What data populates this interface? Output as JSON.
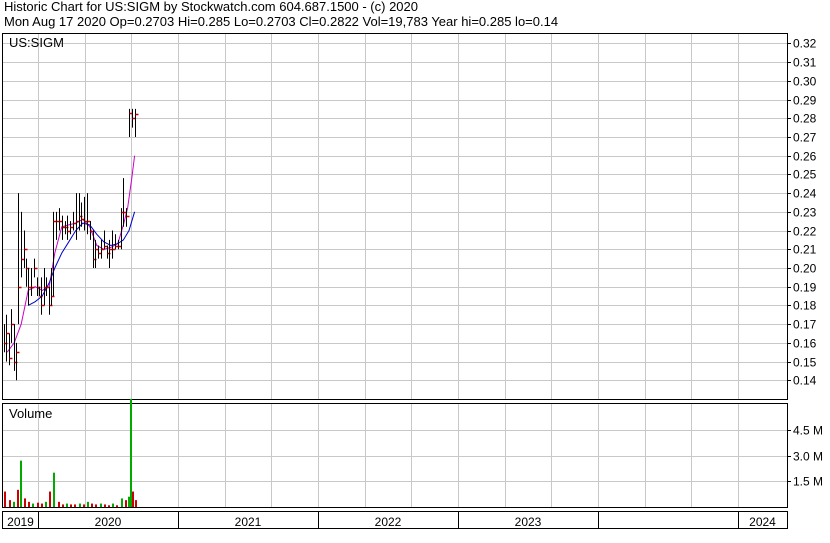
{
  "header": {
    "line1": "Historic Chart for US:SIGM by Stockwatch.com 604.687.1500 - (c) 2020",
    "line2": "Mon Aug 17 2020   Op=0.2703   Hi=0.285   Lo=0.2703   Cl=0.2822   Vol=19,783   Year hi=0.285   lo=0.14"
  },
  "colors": {
    "price_bar": "#000000",
    "close_tick": "#cc0000",
    "ma_short": "#cc00cc",
    "ma_long": "#0000cc",
    "volume_up": "#00aa00",
    "volume_down": "#cc0000",
    "grid": "#c8c8c8"
  },
  "chart_data": [
    {
      "type": "bar",
      "subtype": "ohlc",
      "title": "US:SIGM",
      "ylim": [
        0.13,
        0.325
      ],
      "y_ticks": [
        0.14,
        0.15,
        0.16,
        0.17,
        0.18,
        0.19,
        0.2,
        0.21,
        0.22,
        0.23,
        0.24,
        0.25,
        0.26,
        0.27,
        0.28,
        0.29,
        0.3,
        0.31,
        0.32
      ],
      "y_tick_labels": [
        "0.14",
        "0.15",
        "0.16",
        "0.17",
        "0.18",
        "0.19",
        "0.20",
        "0.21",
        "0.22",
        "0.23",
        "0.24",
        "0.25",
        "0.26",
        "0.27",
        "0.28",
        "0.29",
        "0.30",
        "0.31",
        "0.32"
      ],
      "x_years": [
        "2019",
        "2020",
        "2021",
        "2022",
        "2023",
        "2024"
      ],
      "x_domain_years": [
        2018.75,
        2024.35
      ],
      "x_gridlines": [
        2019.0,
        2019.333,
        2019.667,
        2020.0,
        2020.333,
        2020.667,
        2021.0,
        2021.333,
        2021.667,
        2022.0,
        2022.333,
        2022.667,
        2023.0,
        2023.333,
        2023.667,
        2024.0
      ],
      "x_year_boundaries": [
        2019.0,
        2020.0,
        2021.0,
        2022.0,
        2023.0,
        2024.0
      ],
      "grid": true,
      "series": [
        {
          "kind": "hlc",
          "points": [
            [
              2018.755,
              0.155,
              0.17,
              0.16
            ],
            [
              2018.77,
              0.15,
              0.175,
              0.165
            ],
            [
              2018.79,
              0.148,
              0.165,
              0.152
            ],
            [
              2018.81,
              0.16,
              0.178,
              0.17
            ],
            [
              2018.83,
              0.145,
              0.17,
              0.15
            ],
            [
              2018.845,
              0.14,
              0.16,
              0.155
            ],
            [
              2018.86,
              0.17,
              0.24,
              0.19
            ],
            [
              2018.88,
              0.195,
              0.23,
              0.205
            ],
            [
              2018.9,
              0.2,
              0.22,
              0.21
            ],
            [
              2018.915,
              0.19,
              0.205,
              0.2
            ],
            [
              2018.93,
              0.18,
              0.2,
              0.19
            ],
            [
              2018.95,
              0.185,
              0.2,
              0.19
            ],
            [
              2018.97,
              0.195,
              0.205,
              0.2
            ],
            [
              2018.99,
              0.185,
              0.195,
              0.19
            ],
            [
              2019.005,
              0.185,
              0.19,
              0.185
            ],
            [
              2019.02,
              0.175,
              0.195,
              0.18
            ],
            [
              2019.04,
              0.18,
              0.2,
              0.19
            ],
            [
              2019.06,
              0.185,
              0.195,
              0.19
            ],
            [
              2019.075,
              0.175,
              0.19,
              0.18
            ],
            [
              2019.09,
              0.18,
              0.2,
              0.185
            ],
            [
              2019.11,
              0.185,
              0.23,
              0.225
            ],
            [
              2019.13,
              0.215,
              0.23,
              0.225
            ],
            [
              2019.15,
              0.22,
              0.232,
              0.225
            ],
            [
              2019.17,
              0.215,
              0.228,
              0.222
            ],
            [
              2019.19,
              0.218,
              0.225,
              0.222
            ],
            [
              2019.21,
              0.215,
              0.228,
              0.22
            ],
            [
              2019.23,
              0.218,
              0.225,
              0.222
            ],
            [
              2019.25,
              0.22,
              0.23,
              0.224
            ],
            [
              2019.27,
              0.215,
              0.24,
              0.225
            ],
            [
              2019.29,
              0.22,
              0.24,
              0.228
            ],
            [
              2019.31,
              0.222,
              0.235,
              0.226
            ],
            [
              2019.33,
              0.22,
              0.238,
              0.225
            ],
            [
              2019.35,
              0.218,
              0.24,
              0.225
            ],
            [
              2019.37,
              0.215,
              0.225,
              0.22
            ],
            [
              2019.39,
              0.2,
              0.22,
              0.205
            ],
            [
              2019.41,
              0.2,
              0.215,
              0.21
            ],
            [
              2019.43,
              0.205,
              0.212,
              0.208
            ],
            [
              2019.45,
              0.205,
              0.215,
              0.21
            ],
            [
              2019.47,
              0.21,
              0.22,
              0.212
            ],
            [
              2019.49,
              0.205,
              0.212,
              0.208
            ],
            [
              2019.51,
              0.2,
              0.215,
              0.21
            ],
            [
              2019.53,
              0.205,
              0.22,
              0.21
            ],
            [
              2019.55,
              0.21,
              0.218,
              0.212
            ],
            [
              2019.57,
              0.21,
              0.215,
              0.212
            ],
            [
              2019.59,
              0.21,
              0.232,
              0.23
            ],
            [
              2019.61,
              0.222,
              0.248,
              0.23
            ],
            [
              2019.63,
              0.222,
              0.232,
              0.228
            ],
            [
              2019.65,
              0.27,
              0.285,
              0.283
            ],
            [
              2019.67,
              0.275,
              0.285,
              0.28
            ],
            [
              2019.69,
              0.27,
              0.285,
              0.282
            ]
          ]
        },
        {
          "kind": "line",
          "role": "ma_short",
          "x": [
            2018.78,
            2018.83,
            2018.88,
            2018.93,
            2018.98,
            2019.03,
            2019.08,
            2019.12,
            2019.17,
            2019.22,
            2019.27,
            2019.32,
            2019.37,
            2019.42,
            2019.47,
            2019.52,
            2019.57,
            2019.61,
            2019.64,
            2019.67,
            2019.69
          ],
          "y": [
            0.155,
            0.16,
            0.17,
            0.188,
            0.19,
            0.188,
            0.19,
            0.208,
            0.222,
            0.223,
            0.224,
            0.226,
            0.222,
            0.212,
            0.21,
            0.211,
            0.213,
            0.223,
            0.232,
            0.248,
            0.26
          ]
        },
        {
          "kind": "line",
          "role": "ma_long",
          "x": [
            2018.93,
            2018.98,
            2019.03,
            2019.08,
            2019.12,
            2019.17,
            2019.22,
            2019.27,
            2019.32,
            2019.37,
            2019.42,
            2019.47,
            2019.52,
            2019.57,
            2019.61,
            2019.65,
            2019.69
          ],
          "y": [
            0.18,
            0.182,
            0.185,
            0.192,
            0.2,
            0.208,
            0.214,
            0.22,
            0.224,
            0.223,
            0.218,
            0.214,
            0.212,
            0.213,
            0.215,
            0.22,
            0.23
          ]
        }
      ]
    },
    {
      "type": "bar",
      "title": "Volume",
      "ylim": [
        0,
        6000000
      ],
      "y_ticks": [
        1500000,
        3000000,
        4500000
      ],
      "y_tick_labels": [
        "1.5 M",
        "3.0 M",
        "4.5 M"
      ],
      "series": [
        {
          "kind": "volume",
          "x": [
            2018.76,
            2018.79,
            2018.82,
            2018.85,
            2018.87,
            2018.9,
            2018.93,
            2018.96,
            2018.99,
            2019.02,
            2019.05,
            2019.08,
            2019.11,
            2019.14,
            2019.17,
            2019.2,
            2019.23,
            2019.26,
            2019.29,
            2019.32,
            2019.35,
            2019.38,
            2019.41,
            2019.44,
            2019.47,
            2019.5,
            2019.53,
            2019.56,
            2019.59,
            2019.62,
            2019.64,
            2019.655,
            2019.67,
            2019.69
          ],
          "values": [
            900000,
            400000,
            300000,
            1000000,
            2700000,
            500000,
            300000,
            200000,
            250000,
            200000,
            300000,
            900000,
            2000000,
            300000,
            150000,
            200000,
            150000,
            150000,
            200000,
            150000,
            300000,
            200000,
            150000,
            200000,
            150000,
            100000,
            200000,
            100000,
            500000,
            400000,
            600000,
            6300000,
            900000,
            400000
          ],
          "up": [
            false,
            false,
            true,
            false,
            true,
            false,
            false,
            true,
            false,
            false,
            true,
            false,
            true,
            false,
            false,
            true,
            false,
            false,
            true,
            false,
            true,
            false,
            false,
            true,
            false,
            false,
            true,
            false,
            true,
            false,
            true,
            true,
            false,
            false
          ]
        }
      ]
    }
  ]
}
